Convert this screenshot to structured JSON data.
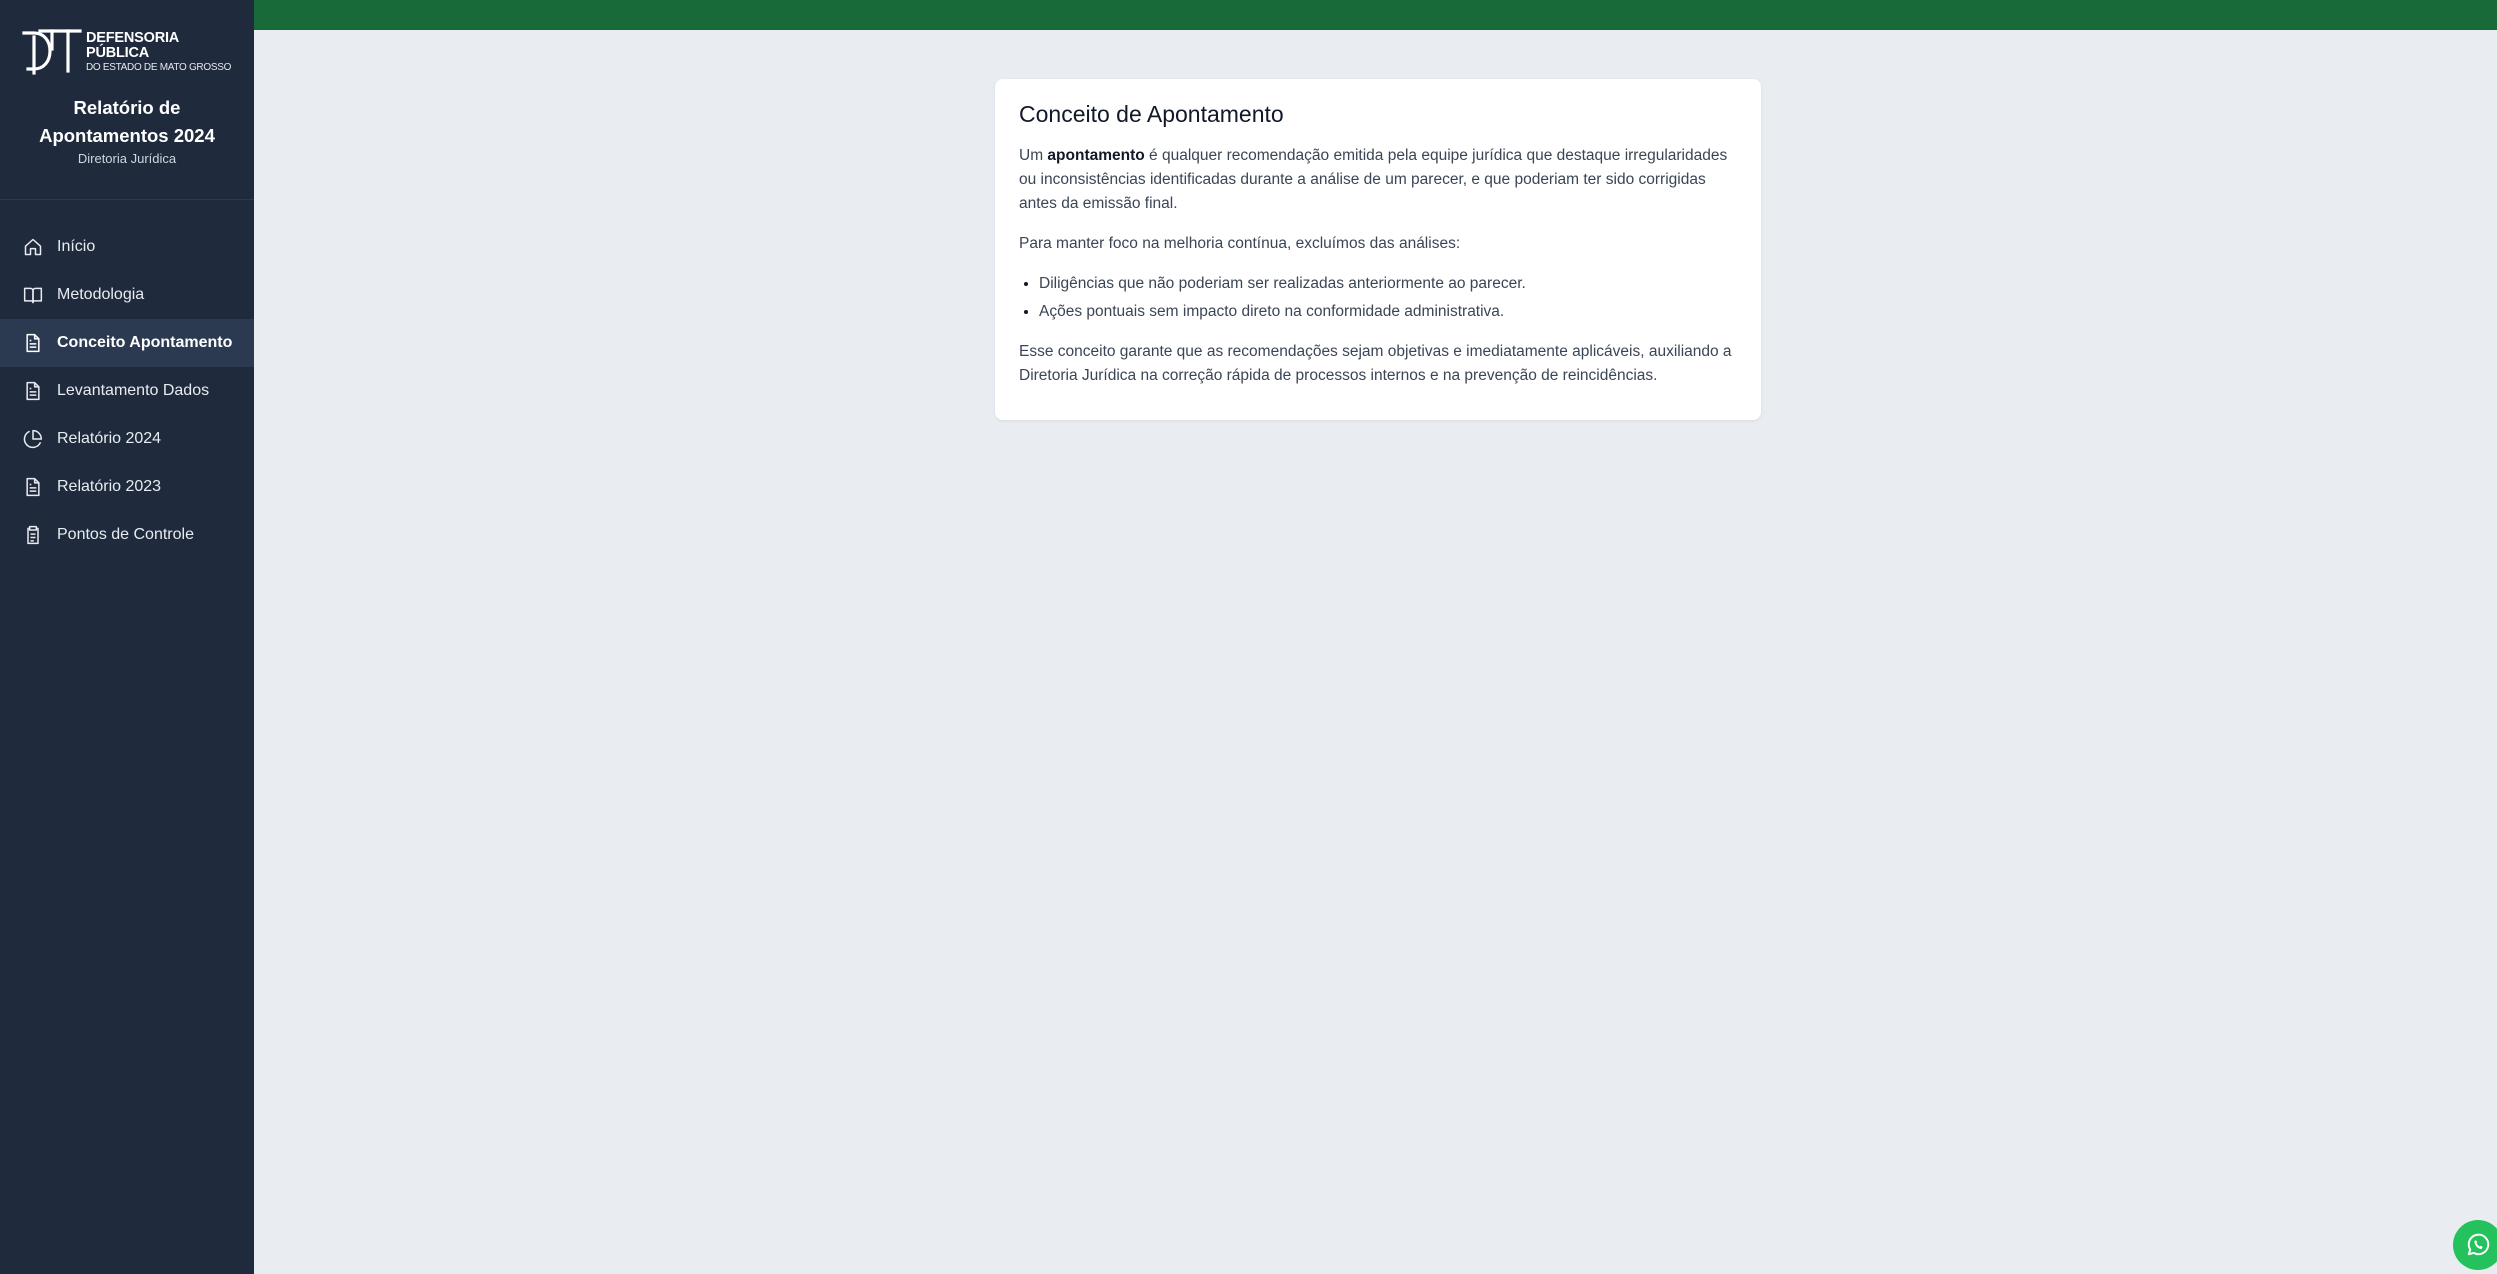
{
  "brand": {
    "logo_line1": "DEFENSORIA PÚBLICA",
    "logo_line2": "DO ESTADO DE MATO GROSSO",
    "title": "Relatório de Apontamentos 2024",
    "subtitle": "Diretoria Jurídica"
  },
  "nav": {
    "items": [
      {
        "label": "Início",
        "icon": "home-icon"
      },
      {
        "label": "Metodologia",
        "icon": "book-open-icon"
      },
      {
        "label": "Conceito Apontamento",
        "icon": "file-text-icon",
        "active": true
      },
      {
        "label": "Levantamento Dados",
        "icon": "file-text-icon"
      },
      {
        "label": "Relatório 2024",
        "icon": "pie-chart-icon"
      },
      {
        "label": "Relatório 2023",
        "icon": "file-text-icon"
      },
      {
        "label": "Pontos de Controle",
        "icon": "clipboard-icon"
      }
    ]
  },
  "colors": {
    "sidebar": "#1f2a3c",
    "topbar": "#186a38",
    "background": "#e9edf2",
    "whatsapp": "#25c15c"
  },
  "content": {
    "title": "Conceito de Apontamento",
    "p1_before": "Um ",
    "p1_bold": "apontamento",
    "p1_after": " é qualquer recomendação emitida pela equipe jurídica que destaque irregularidades ou inconsistências identificadas durante a análise de um parecer, e que poderiam ter sido corrigidas antes da emissão final.",
    "p2": "Para manter foco na melhoria contínua, excluímos das análises:",
    "bullets": [
      "Diligências que não poderiam ser realizadas anteriormente ao parecer.",
      "Ações pontuais sem impacto direto na conformidade administrativa."
    ],
    "p3": "Esse conceito garante que as recomendações sejam objetivas e imediatamente aplicáveis, auxiliando a Diretoria Jurídica na correção rápida de processos internos e na prevenção de reincidências."
  },
  "whatsapp": {
    "icon": "whatsapp-icon"
  }
}
